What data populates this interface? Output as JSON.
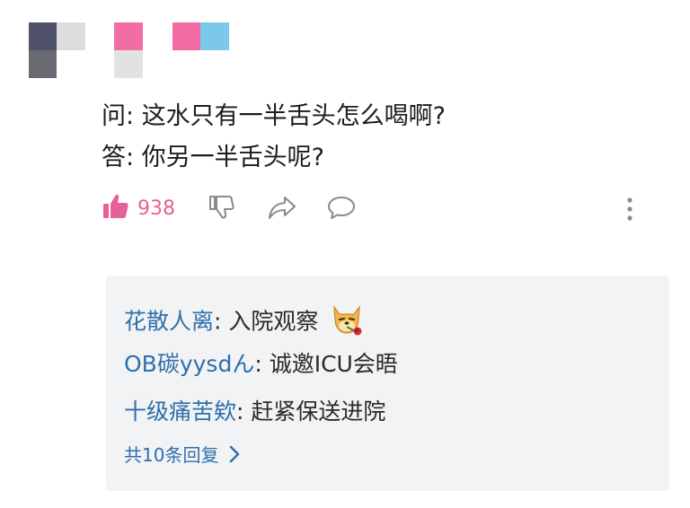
{
  "avatar": {
    "colors": [
      "#4f5268",
      "#dcdcde",
      "#6a6a72",
      "#ffffff"
    ]
  },
  "username_blocks": {
    "colors": [
      "#f06ea3",
      "#e2e2e2",
      "#f26ba4",
      "#7cc8ea"
    ]
  },
  "post": {
    "question": "问: 这水只有一半舌头怎么喝啊?",
    "answer": "答: 你另一半舌头呢?"
  },
  "actions": {
    "like_count": "938",
    "like_icon": "thumbs-up-icon",
    "dislike_icon": "thumbs-down-icon",
    "share_icon": "share-icon",
    "comment_icon": "comment-icon",
    "more_icon": "more-vertical-icon",
    "like_color": "#e8609a"
  },
  "replies": [
    {
      "user": "花散人离",
      "sep": ": ",
      "text": "入院观察",
      "emoji": "doge-rose-emoji"
    },
    {
      "user": "OB碳yysdん",
      "sep": ": ",
      "text": "诚邀ICU会晤"
    },
    {
      "user": "十级痛苦欸",
      "sep": ": ",
      "text": "赶紧保送进院"
    }
  ],
  "more_replies": "共10条回复",
  "colors": {
    "link": "#2f6fab",
    "reply_bg": "#f2f3f4"
  }
}
